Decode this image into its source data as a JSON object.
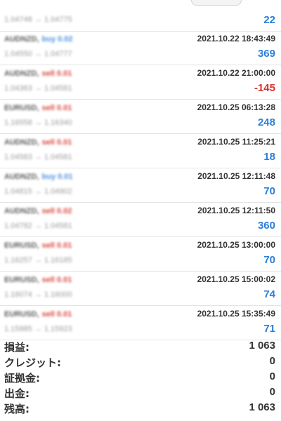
{
  "first_row": {
    "prices": "1.04748 → 1.04775",
    "profit": "22"
  },
  "deals": [
    {
      "symbol": "AUDNZD,",
      "side": "buy",
      "side_label": "buy 0.02",
      "time": "2021.10.22 18:43:49",
      "prices": "1.04550 → 1.04777",
      "profit": "369",
      "sign": "pos"
    },
    {
      "symbol": "AUDNZD,",
      "side": "sell",
      "side_label": "sell 0.01",
      "time": "2021.10.22 21:00:00",
      "prices": "1.04363 → 1.04581",
      "profit": "-145",
      "sign": "neg"
    },
    {
      "symbol": "EURUSD,",
      "side": "sell",
      "side_label": "sell 0.01",
      "time": "2021.10.25 06:13:28",
      "prices": "1.16558 → 1.16340",
      "profit": "248",
      "sign": "pos"
    },
    {
      "symbol": "AUDNZD,",
      "side": "sell",
      "side_label": "sell 0.01",
      "time": "2021.10.25 11:25:21",
      "prices": "1.04583 → 1.04581",
      "profit": "18",
      "sign": "pos"
    },
    {
      "symbol": "AUDNZD,",
      "side": "buy",
      "side_label": "buy 0.01",
      "time": "2021.10.25 12:11:48",
      "prices": "1.04815 → 1.04902",
      "profit": "70",
      "sign": "pos"
    },
    {
      "symbol": "AUDNZD,",
      "side": "sell",
      "side_label": "sell 0.02",
      "time": "2021.10.25 12:11:50",
      "prices": "1.04782 → 1.04581",
      "profit": "360",
      "sign": "pos"
    },
    {
      "symbol": "EURUSD,",
      "side": "sell",
      "side_label": "sell 0.01",
      "time": "2021.10.25 13:00:00",
      "prices": "1.16257 → 1.16185",
      "profit": "70",
      "sign": "pos"
    },
    {
      "symbol": "EURUSD,",
      "side": "sell",
      "side_label": "sell 0.01",
      "time": "2021.10.25 15:00:02",
      "prices": "1.16074 → 1.16000",
      "profit": "74",
      "sign": "pos"
    },
    {
      "symbol": "EURUSD,",
      "side": "sell",
      "side_label": "sell 0.01",
      "time": "2021.10.25 15:35:49",
      "prices": "1.15985 → 1.15923",
      "profit": "71",
      "sign": "pos"
    }
  ],
  "summary": [
    {
      "label": "損益:",
      "value": "1 063"
    },
    {
      "label": "クレジット:",
      "value": "0"
    },
    {
      "label": "証拠金:",
      "value": "0"
    },
    {
      "label": "出金:",
      "value": "0"
    },
    {
      "label": "残高:",
      "value": "1 063"
    }
  ],
  "colors": {
    "positive": "#2b7fd6",
    "negative": "#d9302c",
    "buy": "#4a8fe0",
    "sell": "#d9463e"
  }
}
